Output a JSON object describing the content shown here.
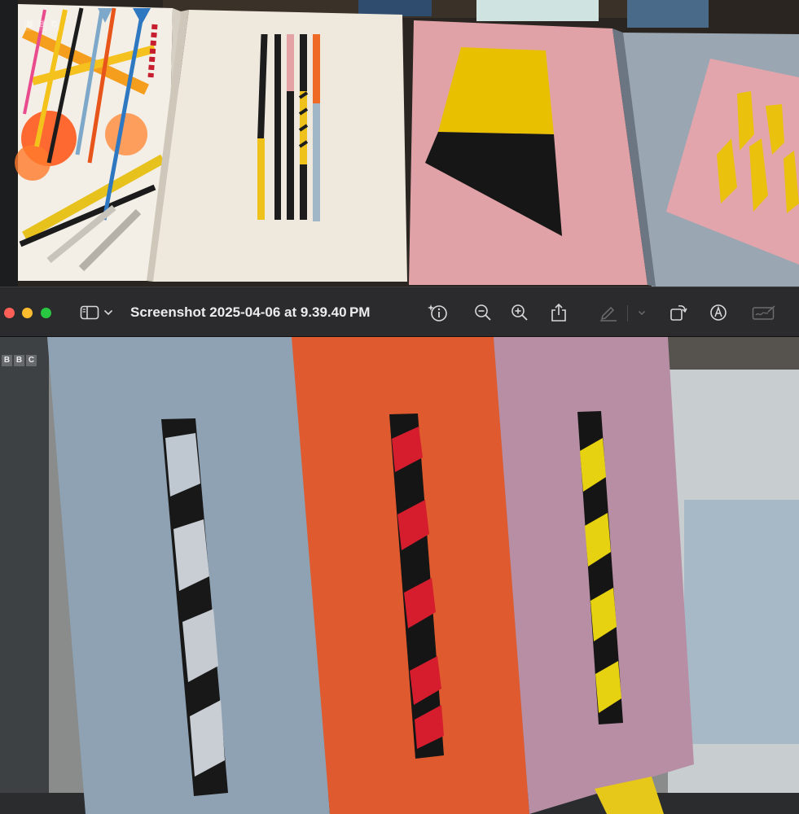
{
  "window": {
    "title": "Screenshot 2025-04-06 at 9.39.40 PM"
  },
  "watermark": {
    "letters": [
      "B",
      "B",
      "C"
    ]
  },
  "toolbar": {
    "tools": [
      {
        "name": "sidebar-toggle",
        "icon": "sidebar-icon"
      },
      {
        "name": "sidebar-menu",
        "icon": "chevron-down-icon"
      },
      {
        "name": "info",
        "icon": "info-sparkle-icon"
      },
      {
        "name": "zoom-out",
        "icon": "zoom-out-icon"
      },
      {
        "name": "zoom-in",
        "icon": "zoom-in-icon"
      },
      {
        "name": "share",
        "icon": "share-icon"
      },
      {
        "name": "highlight",
        "icon": "pencil-icon",
        "disabled": true
      },
      {
        "name": "highlight-menu",
        "icon": "chevron-down-icon",
        "disabled": true
      },
      {
        "name": "rotate",
        "icon": "rotate-icon"
      },
      {
        "name": "markup",
        "icon": "markup-icon"
      },
      {
        "name": "sign",
        "icon": "signature-icon",
        "disabled": true
      }
    ]
  },
  "colors": {
    "close": "#ff5f57",
    "minimize": "#febc2e",
    "zoom": "#28c840",
    "toolbar_bg": "#2b2b2d",
    "icon": "#d8d8d8",
    "icon_disabled": "#6d6d70"
  }
}
